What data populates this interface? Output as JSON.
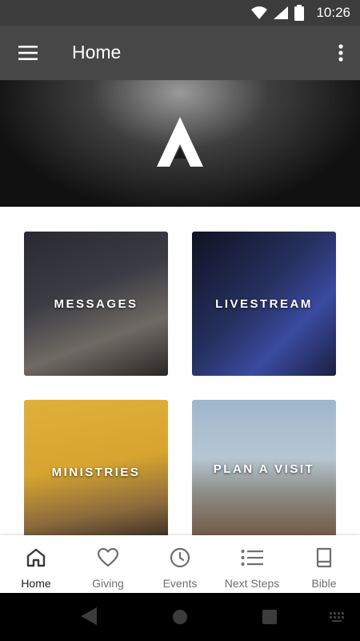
{
  "status": {
    "time": "10:26",
    "wifi_icon": "wifi-icon",
    "signal_icon": "signal-icon",
    "battery_icon": "battery-icon"
  },
  "appbar": {
    "title": "Home",
    "menu_icon": "hamburger-menu-icon",
    "more_icon": "more-vert-icon",
    "color": "#474747"
  },
  "hero": {
    "logo_icon": "church-logo-a-icon"
  },
  "tiles": [
    {
      "label": "MESSAGES"
    },
    {
      "label": "LIVESTREAM"
    },
    {
      "label": "MINISTRIES"
    },
    {
      "label": "PLAN A VISIT"
    }
  ],
  "bottom_nav": {
    "items": [
      {
        "label": "Home",
        "icon": "home-icon",
        "active": true
      },
      {
        "label": "Giving",
        "icon": "heart-icon",
        "active": false
      },
      {
        "label": "Events",
        "icon": "clock-icon",
        "active": false
      },
      {
        "label": "Next Steps",
        "icon": "list-icon",
        "active": false
      },
      {
        "label": "Bible",
        "icon": "book-icon",
        "active": false
      }
    ]
  },
  "system_nav": {
    "back_icon": "back-triangle-icon",
    "home_icon": "home-circle-icon",
    "recents_icon": "recents-square-icon",
    "keyboard_icon": "keyboard-icon"
  }
}
